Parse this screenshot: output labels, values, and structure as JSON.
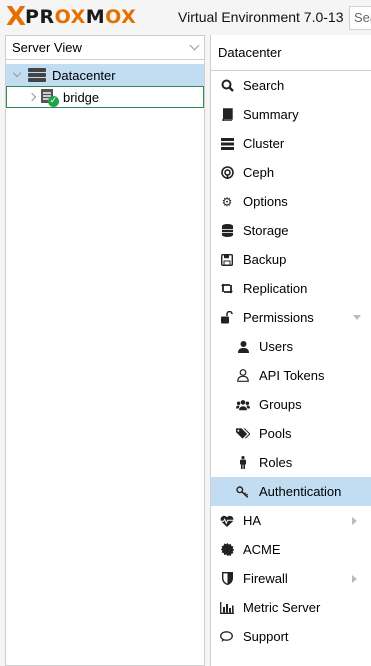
{
  "header": {
    "logo_x": "X",
    "logo_word": "PROXMOX",
    "version": "Virtual Environment 7.0-13",
    "search_placeholder": "Search"
  },
  "left": {
    "view_selector": "Server View",
    "tree": [
      {
        "label": "Datacenter",
        "icon": "server-rack-icon",
        "selected": true
      },
      {
        "label": "bridge",
        "icon": "node-online-icon",
        "status": "online"
      }
    ]
  },
  "right": {
    "title": "Datacenter",
    "menu": [
      {
        "label": "Search",
        "icon": "search-icon"
      },
      {
        "label": "Summary",
        "icon": "book-icon"
      },
      {
        "label": "Cluster",
        "icon": "server-icon"
      },
      {
        "label": "Ceph",
        "icon": "ceph-icon"
      },
      {
        "label": "Options",
        "icon": "gear-icon"
      },
      {
        "label": "Storage",
        "icon": "database-icon"
      },
      {
        "label": "Backup",
        "icon": "floppy-icon"
      },
      {
        "label": "Replication",
        "icon": "retweet-icon"
      },
      {
        "label": "Permissions",
        "icon": "unlock-icon",
        "expanded": true
      },
      {
        "label": "Users",
        "icon": "user-icon",
        "sub": true
      },
      {
        "label": "API Tokens",
        "icon": "user-outline-icon",
        "sub": true
      },
      {
        "label": "Groups",
        "icon": "users-icon",
        "sub": true
      },
      {
        "label": "Pools",
        "icon": "tags-icon",
        "sub": true
      },
      {
        "label": "Roles",
        "icon": "male-icon",
        "sub": true
      },
      {
        "label": "Authentication",
        "icon": "key-icon",
        "sub": true,
        "active": true
      },
      {
        "label": "HA",
        "icon": "heartbeat-icon",
        "collapsed": true
      },
      {
        "label": "ACME",
        "icon": "certificate-icon"
      },
      {
        "label": "Firewall",
        "icon": "shield-icon",
        "collapsed": true
      },
      {
        "label": "Metric Server",
        "icon": "bar-chart-icon"
      },
      {
        "label": "Support",
        "icon": "comments-icon"
      }
    ]
  },
  "colors": {
    "accent": "#e57000",
    "selection": "#c2ddf2",
    "status_ok": "#22a34a"
  }
}
